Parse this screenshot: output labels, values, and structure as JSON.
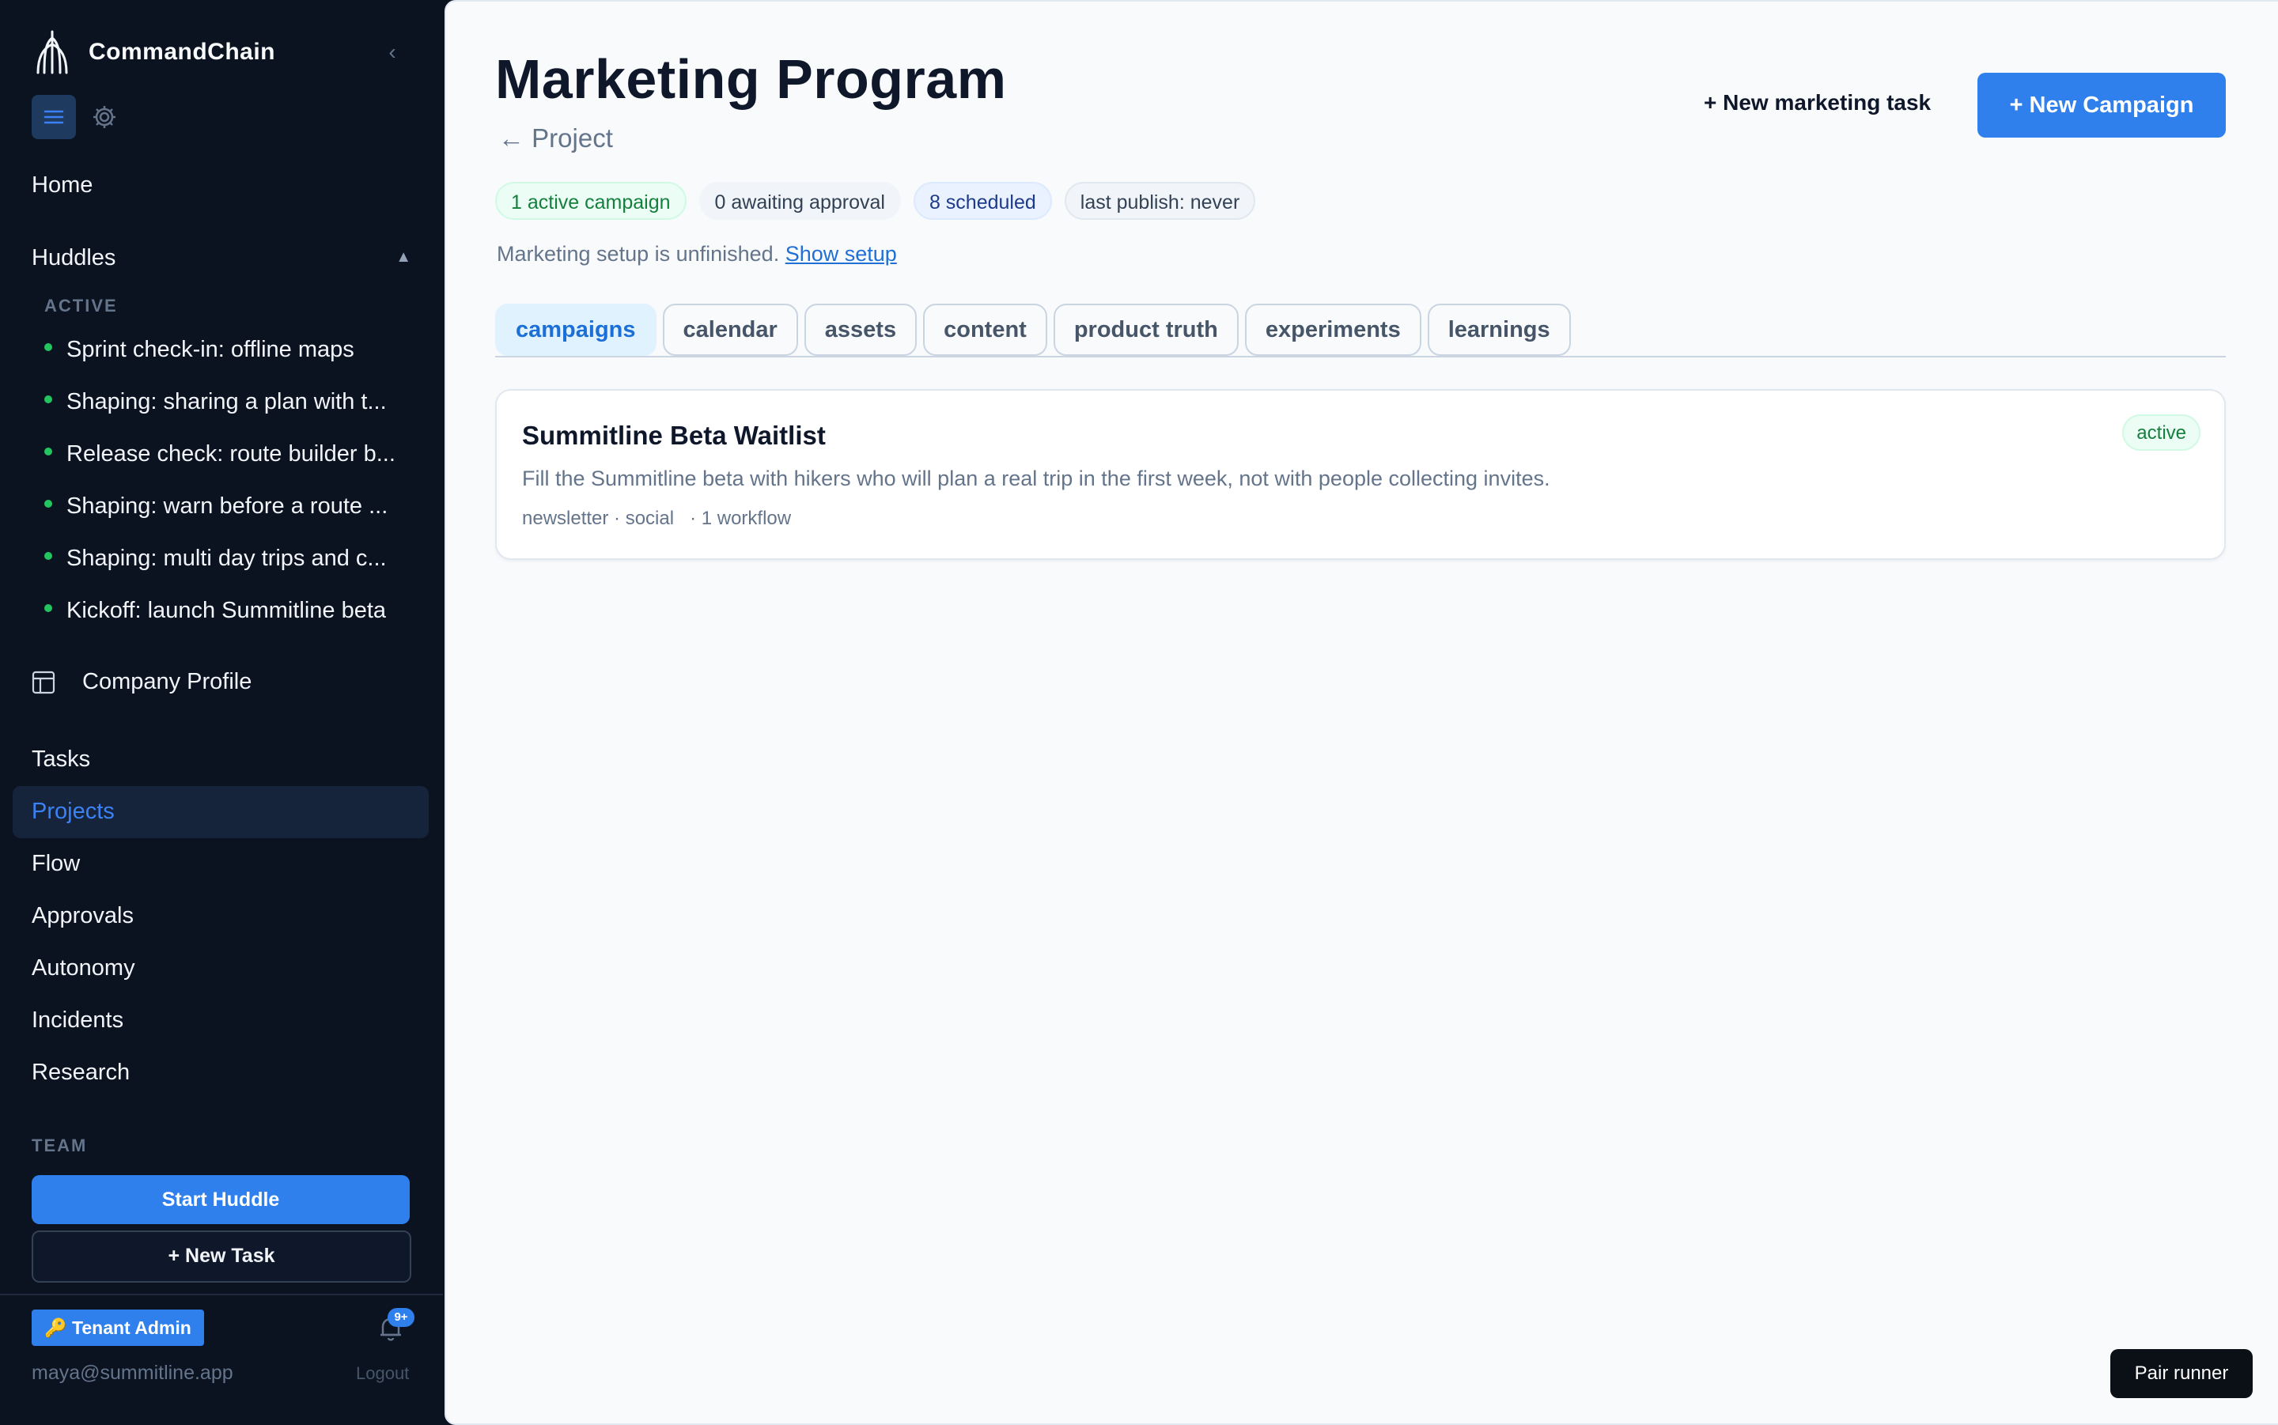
{
  "sidebar": {
    "brand": "CommandChain",
    "collapse_glyph": "‹",
    "nav_top": [
      "Home"
    ],
    "huddles": {
      "label": "Huddles",
      "caret": "▲",
      "active_label": "ACTIVE",
      "items": [
        "Sprint check-in: offline maps",
        "Shaping: sharing a plan with t...",
        "Release check: route builder b...",
        "Shaping: warn before a route ...",
        "Shaping: multi day trips and c...",
        "Kickoff: launch Summitline beta"
      ]
    },
    "company_profile": "Company Profile",
    "nav": [
      "Tasks",
      "Projects",
      "Flow",
      "Approvals",
      "Autonomy",
      "Incidents",
      "Research"
    ],
    "active_nav": "Projects",
    "team_label": "TEAM",
    "start_huddle": "Start Huddle",
    "new_task": "+ New Task",
    "tenant_badge": "🔑 Tenant Admin",
    "notifications": "9+",
    "email": "maya@summitline.app",
    "logout": "Logout"
  },
  "main": {
    "title": "Marketing Program",
    "back_link": "← Project",
    "new_marketing_task": "+ New marketing task",
    "new_campaign": "+ New Campaign",
    "chips": [
      "1 active campaign",
      "0 awaiting approval",
      "8 scheduled",
      "last publish: never"
    ],
    "setup_note": "Marketing setup is unfinished.",
    "setup_link": "Show setup",
    "tabs": [
      "campaigns",
      "calendar",
      "assets",
      "content",
      "product truth",
      "experiments",
      "learnings"
    ],
    "active_tab": "campaigns",
    "campaign": {
      "title": "Summitline Beta Waitlist",
      "status": "active",
      "description": "Fill the Summitline beta with hikers who will plan a real trip in the first week, not with people collecting invites.",
      "meta": "newsletter · social   · 1 workflow"
    },
    "pair_runner": "Pair runner"
  },
  "colors": {
    "accent": "#2f80ed",
    "sidebar_bg": "#0b1220",
    "main_bg": "#f8fafc",
    "status_green": "#22c55e"
  },
  "icons": {
    "brand": "commandchain-logo",
    "menu": "menu-icon",
    "settings": "gear-icon",
    "company": "layout-icon",
    "bell": "bell-icon"
  }
}
